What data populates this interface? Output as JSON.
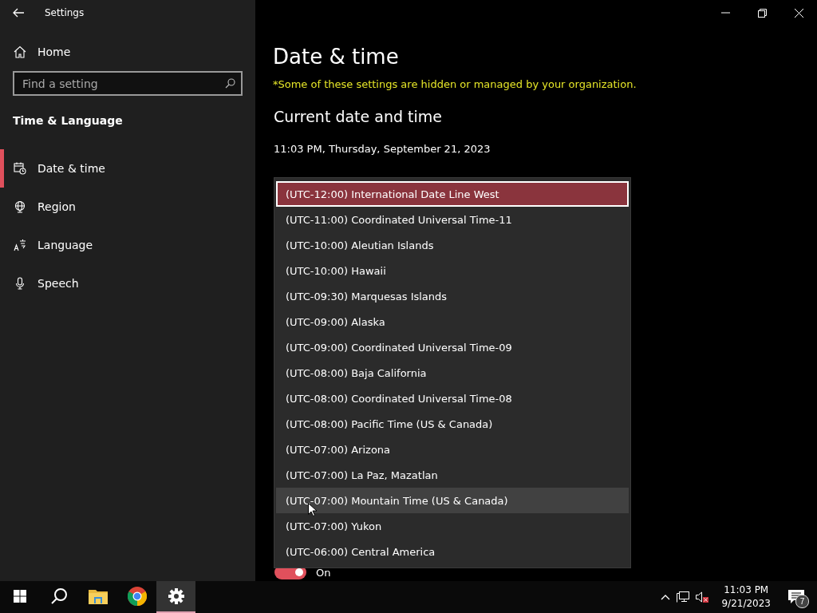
{
  "window": {
    "title": "Settings"
  },
  "sidebar": {
    "home": "Home",
    "search": {
      "placeholder": "Find a setting"
    },
    "section": "Time & Language",
    "items": [
      {
        "label": "Date & time",
        "selected": true
      },
      {
        "label": "Region",
        "selected": false
      },
      {
        "label": "Language",
        "selected": false
      },
      {
        "label": "Speech",
        "selected": false
      }
    ]
  },
  "main": {
    "title": "Date & time",
    "notice": "*Some of these settings are hidden or managed by your organization.",
    "heading": "Current date and time",
    "current": "11:03 PM, Thursday, September 21, 2023",
    "toggle": {
      "on": true,
      "label": "On"
    }
  },
  "timezone_list": [
    {
      "label": "(UTC-12:00) International Date Line West",
      "selected": true,
      "hovered": false
    },
    {
      "label": "(UTC-11:00) Coordinated Universal Time-11",
      "selected": false,
      "hovered": false
    },
    {
      "label": "(UTC-10:00) Aleutian Islands",
      "selected": false,
      "hovered": false
    },
    {
      "label": "(UTC-10:00) Hawaii",
      "selected": false,
      "hovered": false
    },
    {
      "label": "(UTC-09:30) Marquesas Islands",
      "selected": false,
      "hovered": false
    },
    {
      "label": "(UTC-09:00) Alaska",
      "selected": false,
      "hovered": false
    },
    {
      "label": "(UTC-09:00) Coordinated Universal Time-09",
      "selected": false,
      "hovered": false
    },
    {
      "label": "(UTC-08:00) Baja California",
      "selected": false,
      "hovered": false
    },
    {
      "label": "(UTC-08:00) Coordinated Universal Time-08",
      "selected": false,
      "hovered": false
    },
    {
      "label": "(UTC-08:00) Pacific Time (US & Canada)",
      "selected": false,
      "hovered": false
    },
    {
      "label": "(UTC-07:00) Arizona",
      "selected": false,
      "hovered": false
    },
    {
      "label": "(UTC-07:00) La Paz, Mazatlan",
      "selected": false,
      "hovered": false
    },
    {
      "label": "(UTC-07:00) Mountain Time (US & Canada)",
      "selected": false,
      "hovered": true
    },
    {
      "label": "(UTC-07:00) Yukon",
      "selected": false,
      "hovered": false
    },
    {
      "label": "(UTC-06:00) Central America",
      "selected": false,
      "hovered": false
    }
  ],
  "taskbar": {
    "apps": [
      {
        "selected": false
      },
      {
        "selected": false
      },
      {
        "selected": false
      },
      {
        "selected": false
      },
      {
        "selected": true
      }
    ],
    "time": "11:03 PM",
    "date": "9/21/2023",
    "notifications": "7"
  }
}
